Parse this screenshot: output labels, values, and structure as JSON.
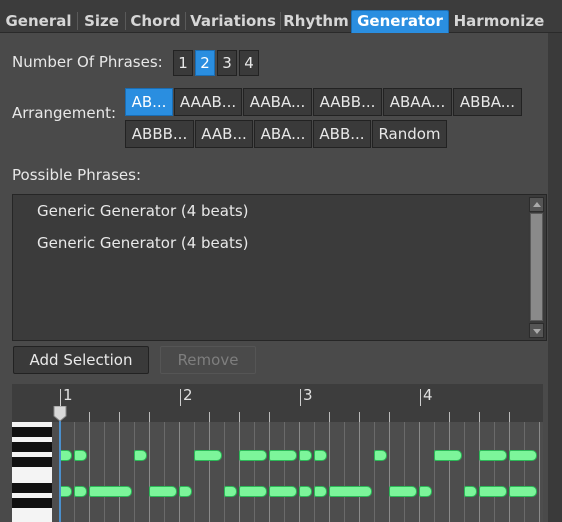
{
  "tabs": [
    {
      "label": "General",
      "active": false
    },
    {
      "label": "Size",
      "active": false
    },
    {
      "label": "Chord",
      "active": false
    },
    {
      "label": "Variations",
      "active": false
    },
    {
      "label": "Rhythm",
      "active": false
    },
    {
      "label": "Generator",
      "active": true
    },
    {
      "label": "Harmonize",
      "active": false
    }
  ],
  "phrases_count": {
    "label": "Number Of Phrases:",
    "options": [
      "1",
      "2",
      "3",
      "4"
    ],
    "selected": "2"
  },
  "arrangement": {
    "label": "Arrangement:",
    "options": [
      "AB...",
      "AAAB...",
      "AABA...",
      "AABB...",
      "ABAA...",
      "ABBA...",
      "ABBB...",
      "AAB...",
      "ABA...",
      "ABB...",
      "Random"
    ],
    "selected": "AB..."
  },
  "possible_phrases": {
    "label": "Possible Phrases:",
    "items": [
      "Generic Generator (4 beats)",
      "Generic Generator (4 beats)"
    ]
  },
  "actions": {
    "add_selection": "Add Selection",
    "remove": "Remove",
    "remove_enabled": false
  },
  "piano_roll": {
    "ruler_labels": [
      "1",
      "2",
      "3",
      "4"
    ],
    "beats": 4,
    "subdivisions_per_beat": 4,
    "playhead_beat": 1.0,
    "notes": [
      {
        "row": "upper",
        "start": 1.0,
        "length": 0.125
      },
      {
        "row": "upper",
        "start": 1.125,
        "length": 0.125
      },
      {
        "row": "upper",
        "start": 1.625,
        "length": 0.125
      },
      {
        "row": "upper",
        "start": 2.125,
        "length": 0.25
      },
      {
        "row": "upper",
        "start": 2.5,
        "length": 0.25
      },
      {
        "row": "upper",
        "start": 2.75,
        "length": 0.25
      },
      {
        "row": "upper",
        "start": 3.0,
        "length": 0.125
      },
      {
        "row": "upper",
        "start": 3.125,
        "length": 0.125
      },
      {
        "row": "upper",
        "start": 3.625,
        "length": 0.125
      },
      {
        "row": "upper",
        "start": 4.125,
        "length": 0.25
      },
      {
        "row": "upper",
        "start": 4.5,
        "length": 0.25
      },
      {
        "row": "upper",
        "start": 4.75,
        "length": 0.25
      },
      {
        "row": "lower",
        "start": 1.0,
        "length": 0.125
      },
      {
        "row": "lower",
        "start": 1.125,
        "length": 0.125
      },
      {
        "row": "lower",
        "start": 1.25,
        "length": 0.375
      },
      {
        "row": "lower",
        "start": 1.75,
        "length": 0.25
      },
      {
        "row": "lower",
        "start": 2.0,
        "length": 0.125
      },
      {
        "row": "lower",
        "start": 2.375,
        "length": 0.125
      },
      {
        "row": "lower",
        "start": 2.5,
        "length": 0.25
      },
      {
        "row": "lower",
        "start": 2.75,
        "length": 0.25
      },
      {
        "row": "lower",
        "start": 3.0,
        "length": 0.125
      },
      {
        "row": "lower",
        "start": 3.125,
        "length": 0.125
      },
      {
        "row": "lower",
        "start": 3.25,
        "length": 0.375
      },
      {
        "row": "lower",
        "start": 3.75,
        "length": 0.25
      },
      {
        "row": "lower",
        "start": 4.0,
        "length": 0.125
      },
      {
        "row": "lower",
        "start": 4.375,
        "length": 0.125
      },
      {
        "row": "lower",
        "start": 4.5,
        "length": 0.25
      },
      {
        "row": "lower",
        "start": 4.75,
        "length": 0.25
      }
    ]
  },
  "colors": {
    "accent": "#2a8ee0",
    "note_fill": "#7cf59a",
    "note_border": "#2bb857",
    "playhead": "#4b8fcc"
  }
}
